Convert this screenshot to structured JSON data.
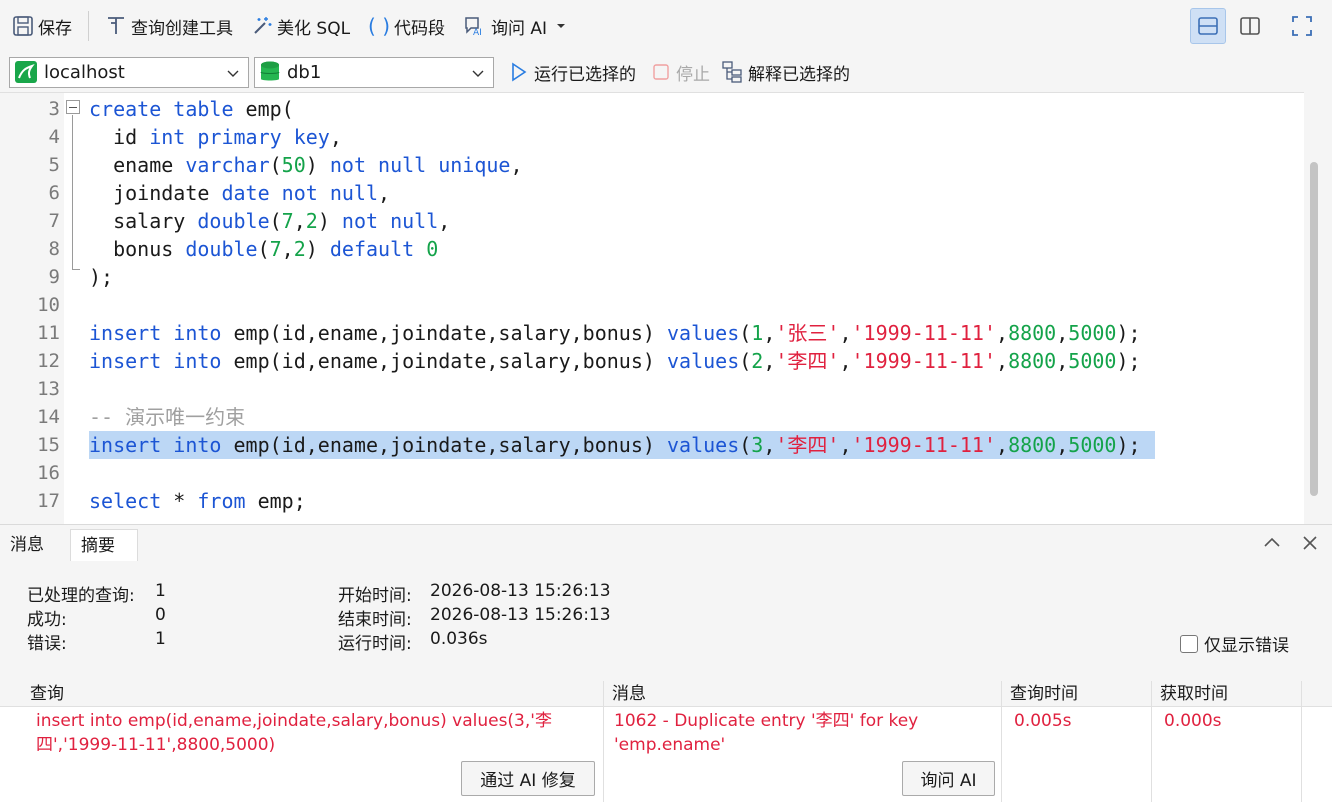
{
  "toolbar": {
    "save": "保存",
    "query_builder": "查询创建工具",
    "beautify": "美化 SQL",
    "snippet": "代码段",
    "ask_ai": "询问 AI"
  },
  "connection": {
    "server": "localhost",
    "database": "db1"
  },
  "actions": {
    "run_selected": "运行已选择的",
    "stop": "停止",
    "explain_selected": "解释已选择的"
  },
  "editor": {
    "line_numbers": [
      "3",
      "4",
      "5",
      "6",
      "7",
      "8",
      "9",
      "10",
      "11",
      "12",
      "13",
      "14",
      "15",
      "16",
      "17"
    ]
  },
  "tabs": {
    "messages": "消息",
    "summary": "摘要"
  },
  "summary": {
    "processed_label": "已处理的查询:",
    "processed": "1",
    "success_label": "成功:",
    "success": "0",
    "errors_label": "错误:",
    "errors": "1",
    "start_label": "开始时间:",
    "start": "2026-08-13 15:26:13",
    "end_label": "结束时间:",
    "end": "2026-08-13 15:26:13",
    "elapsed_label": "运行时间:",
    "elapsed": "0.036s",
    "only_errors": "仅显示错误"
  },
  "grid": {
    "headers": [
      "查询",
      "消息",
      "查询时间",
      "获取时间"
    ],
    "row": {
      "query": "insert into emp(id,ename,joindate,salary,bonus) values(3,'李四','1999-11-11',8800,5000)",
      "message": "1062 - Duplicate entry '李四' for key 'emp.ename'",
      "query_time": "0.005s",
      "fetch_time": "0.000s"
    },
    "fix_button": "通过 AI 修复",
    "ask_button": "询问 AI"
  }
}
